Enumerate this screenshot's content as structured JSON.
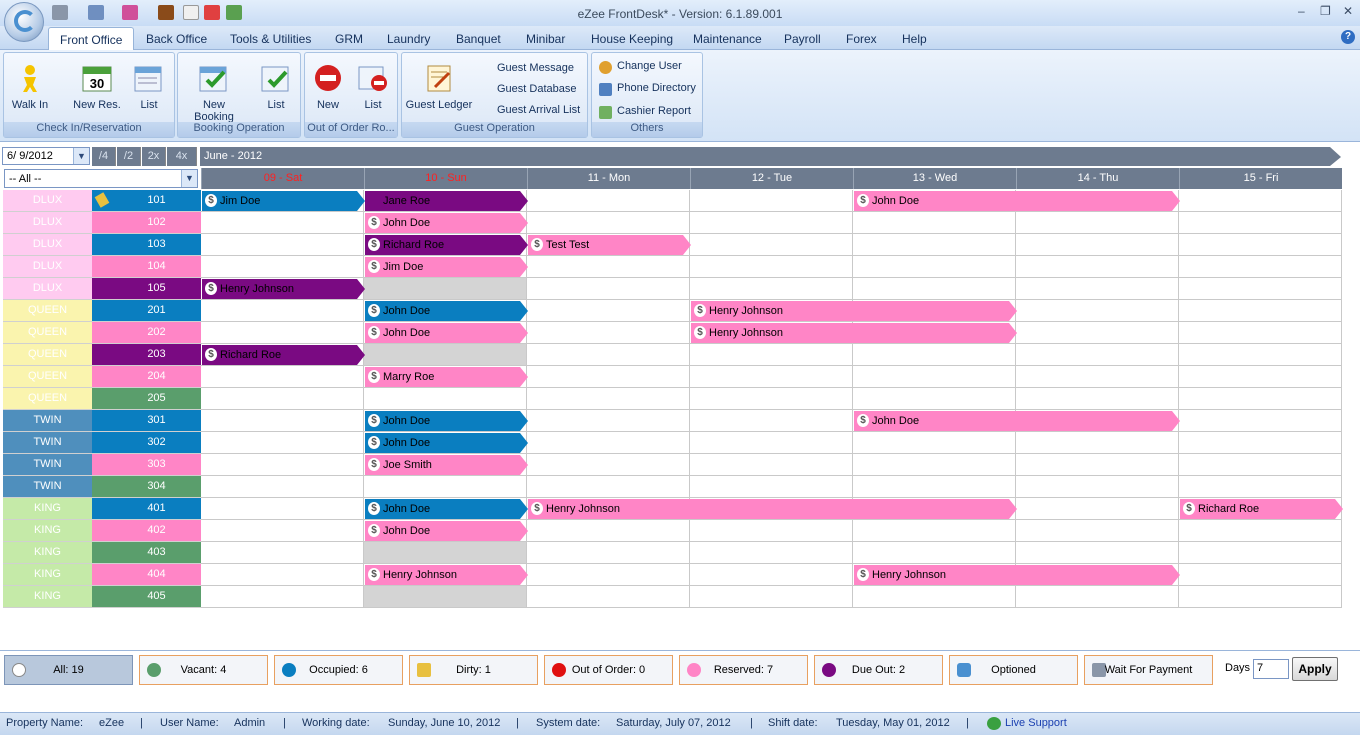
{
  "window": {
    "title": "eZee FrontDesk* - Version: 6.1.89.001"
  },
  "menu": [
    "Front Office",
    "Back Office",
    "Tools & Utilities",
    "GRM",
    "Laundry",
    "Banquet",
    "Minibar",
    "House Keeping",
    "Maintenance",
    "Payroll",
    "Forex",
    "Help"
  ],
  "ribbon": {
    "groups": {
      "checkin": {
        "caption": "Check In/Reservation",
        "walkin": "Walk In",
        "newres": "New Res.",
        "list": "List"
      },
      "booking": {
        "caption": "Booking Operation",
        "newbooking": "New Booking",
        "list": "List"
      },
      "ooo": {
        "caption": "Out of Order Ro...",
        "new": "New",
        "list": "List"
      },
      "guest": {
        "caption": "Guest Operation",
        "ledger": "Guest Ledger",
        "message": "Guest Message",
        "database": "Guest Database",
        "arrival": "Guest Arrival List"
      },
      "others": {
        "caption": "Others",
        "changeuser": "Change User",
        "phone": "Phone Directory",
        "cashier": "Cashier Report"
      }
    }
  },
  "calendar": {
    "date_value": "6/ 9/2012",
    "zoom": [
      "/4",
      "/2",
      "2x",
      "4x"
    ],
    "month_label": "June - 2012",
    "room_filter": "-- All --",
    "days": [
      {
        "label": "09 - Sat",
        "weekend": true
      },
      {
        "label": "10 - Sun",
        "weekend": true
      },
      {
        "label": "11 - Mon",
        "weekend": false
      },
      {
        "label": "12 - Tue",
        "weekend": false
      },
      {
        "label": "13 - Wed",
        "weekend": false
      },
      {
        "label": "14 - Thu",
        "weekend": false
      },
      {
        "label": "15 - Fri",
        "weekend": false
      }
    ],
    "rooms": [
      {
        "type": "DLUX",
        "number": "101",
        "status": "occupied",
        "dirty": true,
        "blocked": []
      },
      {
        "type": "DLUX",
        "number": "102",
        "status": "reserved",
        "dirty": false,
        "blocked": []
      },
      {
        "type": "DLUX",
        "number": "103",
        "status": "occupied",
        "dirty": false,
        "blocked": []
      },
      {
        "type": "DLUX",
        "number": "104",
        "status": "reserved",
        "dirty": false,
        "blocked": []
      },
      {
        "type": "DLUX",
        "number": "105",
        "status": "dueout",
        "dirty": false,
        "blocked": [
          1
        ]
      },
      {
        "type": "QUEEN",
        "number": "201",
        "status": "occupied",
        "dirty": false,
        "blocked": []
      },
      {
        "type": "QUEEN",
        "number": "202",
        "status": "reserved",
        "dirty": false,
        "blocked": []
      },
      {
        "type": "QUEEN",
        "number": "203",
        "status": "dueout",
        "dirty": false,
        "blocked": [
          1
        ]
      },
      {
        "type": "QUEEN",
        "number": "204",
        "status": "reserved",
        "dirty": false,
        "blocked": []
      },
      {
        "type": "QUEEN",
        "number": "205",
        "status": "vacant",
        "dirty": false,
        "blocked": []
      },
      {
        "type": "TWIN",
        "number": "301",
        "status": "occupied",
        "dirty": false,
        "blocked": []
      },
      {
        "type": "TWIN",
        "number": "302",
        "status": "occupied",
        "dirty": false,
        "blocked": []
      },
      {
        "type": "TWIN",
        "number": "303",
        "status": "reserved",
        "dirty": false,
        "blocked": []
      },
      {
        "type": "TWIN",
        "number": "304",
        "status": "vacant",
        "dirty": false,
        "blocked": []
      },
      {
        "type": "KING",
        "number": "401",
        "status": "occupied",
        "dirty": false,
        "blocked": []
      },
      {
        "type": "KING",
        "number": "402",
        "status": "reserved",
        "dirty": false,
        "blocked": []
      },
      {
        "type": "KING",
        "number": "403",
        "status": "vacant",
        "dirty": false,
        "blocked": [
          1
        ]
      },
      {
        "type": "KING",
        "number": "404",
        "status": "reserved",
        "dirty": false,
        "blocked": []
      },
      {
        "type": "KING",
        "number": "405",
        "status": "vacant",
        "dirty": false,
        "blocked": [
          1
        ]
      }
    ],
    "bookings": [
      {
        "room": 0,
        "start": 0,
        "span": 1,
        "kind": "occupied",
        "guest": "Jim Doe",
        "icon": true
      },
      {
        "room": 0,
        "start": 1,
        "span": 1,
        "kind": "dueout",
        "guest": "Jane Roe",
        "icon": false
      },
      {
        "room": 0,
        "start": 4,
        "span": 2,
        "kind": "reserved",
        "guest": "John Doe",
        "icon": true
      },
      {
        "room": 1,
        "start": 1,
        "span": 1,
        "kind": "reserved",
        "guest": "John Doe",
        "icon": true
      },
      {
        "room": 2,
        "start": 1,
        "span": 1,
        "kind": "dueout",
        "guest": "Richard Roe",
        "icon": true
      },
      {
        "room": 2,
        "start": 2,
        "span": 1,
        "kind": "reserved",
        "guest": "Test Test",
        "icon": true
      },
      {
        "room": 3,
        "start": 1,
        "span": 1,
        "kind": "reserved",
        "guest": "Jim Doe",
        "icon": true
      },
      {
        "room": 4,
        "start": 0,
        "span": 1,
        "kind": "dueout",
        "guest": "Henry Johnson",
        "icon": true
      },
      {
        "room": 5,
        "start": 1,
        "span": 1,
        "kind": "occupied",
        "guest": "John Doe",
        "icon": true
      },
      {
        "room": 5,
        "start": 3,
        "span": 2,
        "kind": "reserved",
        "guest": "Henry Johnson",
        "icon": true
      },
      {
        "room": 6,
        "start": 1,
        "span": 1,
        "kind": "reserved",
        "guest": "John Doe",
        "icon": true
      },
      {
        "room": 6,
        "start": 3,
        "span": 2,
        "kind": "reserved",
        "guest": "Henry Johnson",
        "icon": true
      },
      {
        "room": 7,
        "start": 0,
        "span": 1,
        "kind": "dueout",
        "guest": "Richard Roe",
        "icon": true
      },
      {
        "room": 8,
        "start": 1,
        "span": 1,
        "kind": "reserved",
        "guest": "Marry Roe",
        "icon": true
      },
      {
        "room": 10,
        "start": 1,
        "span": 1,
        "kind": "occupied",
        "guest": "John Doe",
        "icon": true
      },
      {
        "room": 10,
        "start": 4,
        "span": 2,
        "kind": "reserved",
        "guest": "John Doe",
        "icon": true
      },
      {
        "room": 11,
        "start": 1,
        "span": 1,
        "kind": "occupied",
        "guest": "John Doe",
        "icon": true
      },
      {
        "room": 12,
        "start": 1,
        "span": 1,
        "kind": "reserved",
        "guest": "Joe Smith",
        "icon": true
      },
      {
        "room": 14,
        "start": 1,
        "span": 1,
        "kind": "occupied",
        "guest": "John Doe",
        "icon": true
      },
      {
        "room": 14,
        "start": 2,
        "span": 3,
        "kind": "reserved",
        "guest": "Henry Johnson",
        "icon": true
      },
      {
        "room": 14,
        "start": 6,
        "span": 1,
        "kind": "reserved",
        "guest": "Richard Roe",
        "icon": true
      },
      {
        "room": 15,
        "start": 1,
        "span": 1,
        "kind": "reserved",
        "guest": "John Doe",
        "icon": true
      },
      {
        "room": 17,
        "start": 1,
        "span": 1,
        "kind": "reserved",
        "guest": "Henry Johnson",
        "icon": true
      },
      {
        "room": 17,
        "start": 4,
        "span": 2,
        "kind": "reserved",
        "guest": "Henry Johnson",
        "icon": true
      }
    ]
  },
  "colors": {
    "occupied": "#0a7ec0",
    "reserved": "#ff85c6",
    "dueout": "#7a0a82",
    "vacant": "#5a9e6c",
    "outoforder": "#e01010",
    "type": {
      "DLUX": "#ffcbf0",
      "QUEEN": "#faf4ae",
      "TWIN": "#4f8fbd",
      "KING": "#c5eaa8"
    }
  },
  "legend": {
    "all": "All: 19",
    "vacant": "Vacant: 4",
    "occupied": "Occupied: 6",
    "dirty": "Dirty: 1",
    "outoforder": "Out of Order: 0",
    "reserved": "Reserved: 7",
    "dueout": "Due Out: 2",
    "optioned": "Optioned",
    "waitpayment": "Wait For Payment",
    "days_label": "Days",
    "days_value": "7",
    "apply": "Apply"
  },
  "status": {
    "property_label": "Property Name:",
    "property": "eZee",
    "user_label": "User Name:",
    "user": "Admin",
    "working_label": "Working date:",
    "working": "Sunday, June 10, 2012",
    "system_label": "System date:",
    "system": "Saturday, July 07, 2012",
    "shift_label": "Shift date:",
    "shift": "Tuesday, May 01, 2012",
    "live": "Live Support",
    "sep": "|"
  }
}
